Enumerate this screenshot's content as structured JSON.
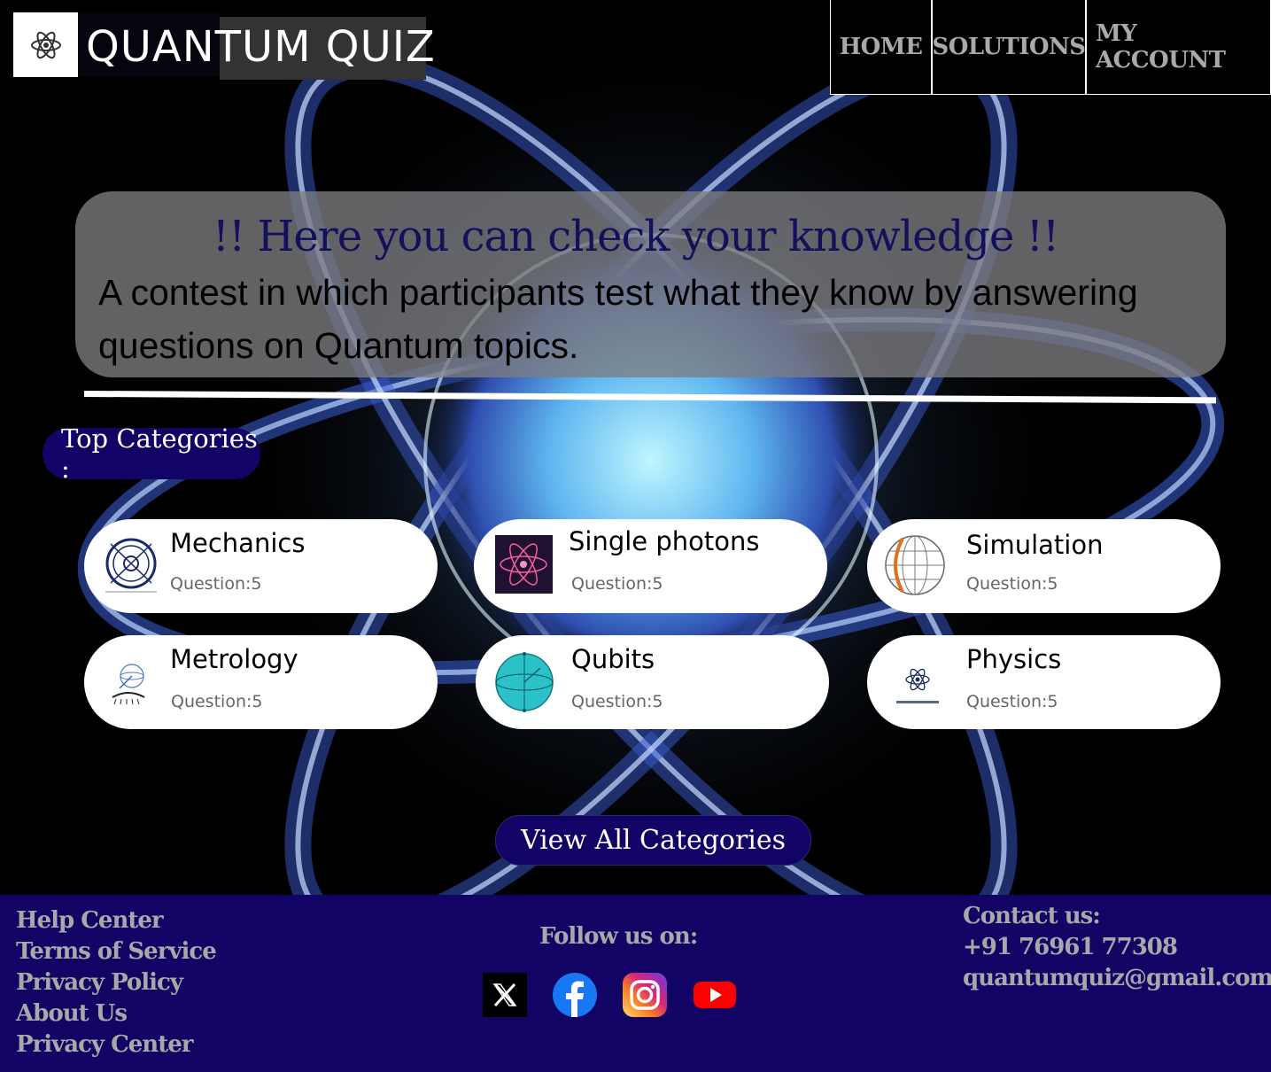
{
  "header": {
    "title": "QUANTUM QUIZ",
    "nav": [
      "HOME",
      "SOLUTIONS",
      "MY ACCOUNT"
    ]
  },
  "hero": {
    "heading": "!! Here you  can check your knowledge !!",
    "text": "A contest in which participants test what they know by answering questions on Quantum topics."
  },
  "categories": {
    "title": "Top Categories :",
    "items": [
      {
        "name": "Mechanics",
        "questions": "Question:5",
        "icon": "quantum-mechanics-logo"
      },
      {
        "name": "Single photons",
        "questions": "Question:5",
        "icon": "atom-photon-icon"
      },
      {
        "name": "Simulation",
        "questions": "Question:5",
        "icon": "globe-icon"
      },
      {
        "name": "Metrology",
        "questions": "Question:5",
        "icon": "eye-sphere-icon"
      },
      {
        "name": "Qubits",
        "questions": "Question:5",
        "icon": "bloch-sphere-icon"
      },
      {
        "name": "Physics",
        "questions": "Question:5",
        "icon": "atom-icon"
      }
    ],
    "view_all": "View All Categories"
  },
  "footer": {
    "links": [
      "Help Center",
      "Terms of Service",
      "Privacy Policy",
      "About Us",
      "Privacy Center"
    ],
    "follow": "Follow us on:",
    "social": [
      "x-icon",
      "facebook-icon",
      "instagram-icon",
      "youtube-icon"
    ],
    "contact_title": "Contact us:",
    "phone": "+91 76961 77308",
    "email": "quantumquiz@gmail.com"
  },
  "colors": {
    "accent": "#120466",
    "footer_bg": "#110465",
    "nav_text": "#a9a9a9"
  }
}
